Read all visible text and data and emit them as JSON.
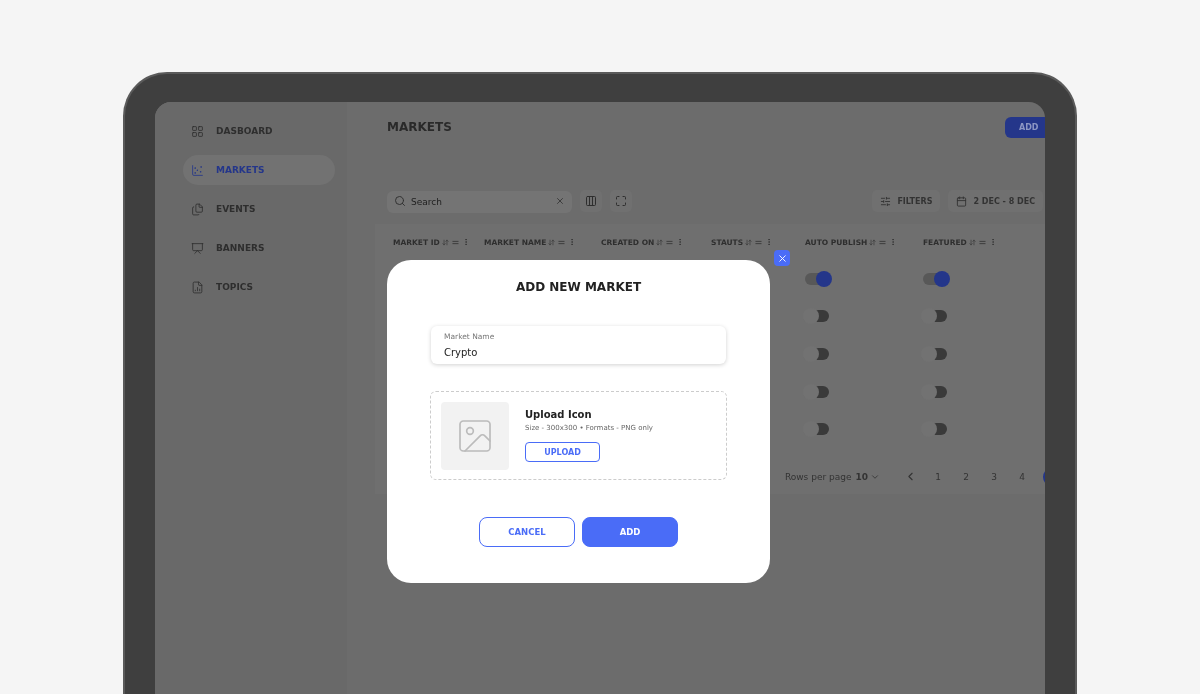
{
  "sidebar": {
    "items": [
      {
        "label": "DASBOARD",
        "selected": false
      },
      {
        "label": "MARKETS",
        "selected": true
      },
      {
        "label": "EVENTS",
        "selected": false
      },
      {
        "label": "BANNERS",
        "selected": false
      },
      {
        "label": "TOPICS",
        "selected": false
      }
    ]
  },
  "page": {
    "title": "MARKETS",
    "add_button": "ADD"
  },
  "toolbar": {
    "search": {
      "placeholder": "Search"
    },
    "filters": "FILTERS",
    "date_range": "2 DEC - 8 DEC"
  },
  "table": {
    "columns": [
      "MARKET ID",
      "MARKET NAME",
      "CREATED ON",
      "STAUTS",
      "AUTO PUBLISH",
      "FEATURED"
    ],
    "rows": [
      {
        "auto_publish": true,
        "featured": true
      },
      {
        "auto_publish": false,
        "featured": false
      },
      {
        "auto_publish": false,
        "featured": false
      },
      {
        "auto_publish": false,
        "featured": false
      },
      {
        "auto_publish": false,
        "featured": false
      }
    ]
  },
  "pagination": {
    "rows_per_page_label": "Rows per page",
    "rows_per_page": "10",
    "pages": [
      {
        "label": "1",
        "selected": false
      },
      {
        "label": "2",
        "selected": false
      },
      {
        "label": "3",
        "selected": false
      },
      {
        "label": "4",
        "selected": false
      }
    ]
  },
  "modal": {
    "title": "ADD NEW MARKET",
    "market_name": {
      "label": "Market Name",
      "value": "Crypto"
    },
    "upload": {
      "title": "Upload Icon",
      "hint": "Size - 300x300 • Formats - PNG only",
      "button": "UPLOAD"
    },
    "buttons": [
      {
        "label": "CANCEL",
        "kind": "secondary"
      },
      {
        "label": "ADD",
        "kind": "primary"
      }
    ]
  }
}
